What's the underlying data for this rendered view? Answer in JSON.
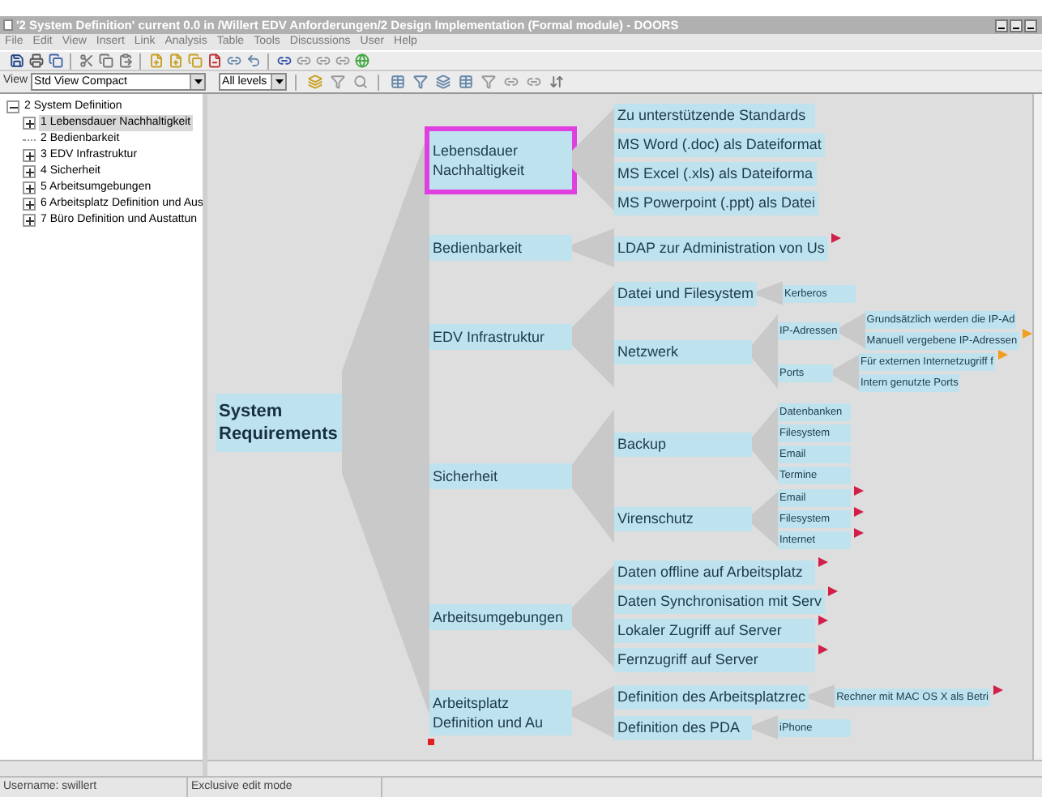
{
  "window": {
    "title": "'2 System Definition' current 0.0 in /Willert EDV Anforderungen/2 Design Implementation (Formal module) - DOORS"
  },
  "menu": [
    "File",
    "Edit",
    "View",
    "Insert",
    "Link",
    "Analysis",
    "Table",
    "Tools",
    "Discussions",
    "User",
    "Help"
  ],
  "view_bar": {
    "label": "View",
    "view": "Std View Compact",
    "levels": "All levels"
  },
  "sidebar": {
    "items": [
      {
        "label": "2 System Definition",
        "has_children": true,
        "expanded": true,
        "selected": false,
        "children": [
          {
            "label": "1 Lebensdauer Nachhaltigkeit",
            "has_children": true,
            "expanded": false,
            "selected": true
          },
          {
            "label": "2 Bedienbarkeit",
            "has_children": false,
            "expanded": false,
            "selected": false
          },
          {
            "label": "3 EDV Infrastruktur",
            "has_children": true,
            "expanded": false,
            "selected": false
          },
          {
            "label": "4 Sicherheit",
            "has_children": true,
            "expanded": false,
            "selected": false
          },
          {
            "label": "5 Arbeitsumgebungen",
            "has_children": true,
            "expanded": false,
            "selected": false
          },
          {
            "label": "6 Arbeitsplatz Definition und Aus",
            "has_children": true,
            "expanded": false,
            "selected": false
          },
          {
            "label": "7 Büro Definition und Austattun",
            "has_children": true,
            "expanded": false,
            "selected": false
          }
        ]
      }
    ]
  },
  "mindmap": {
    "label": "System Requirements",
    "selected": false,
    "children": [
      {
        "label": "Lebensdauer Nachhaltigkeit",
        "selected": true,
        "children": [
          {
            "label": "Zu unterstützende Standards",
            "selected": false
          },
          {
            "label": "MS Word (.doc) als Dateiformat",
            "selected": false
          },
          {
            "label": "MS Excel (.xls) als Dateiforma",
            "selected": false
          },
          {
            "label": "MS Powerpoint (.ppt) als Datei",
            "selected": false
          }
        ]
      },
      {
        "label": "Bedienbarkeit",
        "selected": false,
        "children": [
          {
            "label": "LDAP zur Administration von Us",
            "selected": false,
            "color": "#d0204a"
          }
        ]
      },
      {
        "label": "EDV Infrastruktur",
        "selected": false,
        "children": [
          {
            "label": "Datei und Filesystem",
            "selected": false,
            "children": [
              {
                "label": "Kerberos",
                "selected": false
              }
            ]
          },
          {
            "label": "Netzwerk",
            "selected": false,
            "children": [
              {
                "label": "IP-Adressen",
                "selected": false,
                "children": [
                  {
                    "label": "Grundsätzlich werden die IP-Ad",
                    "selected": false
                  },
                  {
                    "label": "Manuell vergebene IP-Adressen",
                    "selected": false,
                    "color": "#f0a020"
                  }
                ]
              },
              {
                "label": "Ports",
                "selected": false,
                "children": [
                  {
                    "label": "Für externen Internetzugriff f",
                    "selected": false,
                    "color": "#f0a020"
                  },
                  {
                    "label": "Intern genutzte Ports",
                    "selected": false
                  }
                ]
              }
            ]
          }
        ]
      },
      {
        "label": "Sicherheit",
        "selected": false,
        "children": [
          {
            "label": "Backup",
            "selected": false,
            "children": [
              {
                "label": "Datenbanken",
                "selected": false
              },
              {
                "label": "Filesystem",
                "selected": false
              },
              {
                "label": "Email",
                "selected": false
              },
              {
                "label": "Termine",
                "selected": false
              }
            ]
          },
          {
            "label": "Virenschutz",
            "selected": false,
            "children": [
              {
                "label": "Email",
                "selected": false,
                "color": "#d0204a"
              },
              {
                "label": "Filesystem",
                "selected": false,
                "color": "#d0204a"
              },
              {
                "label": "Internet",
                "selected": false,
                "color": "#d0204a"
              }
            ]
          }
        ]
      },
      {
        "label": "Arbeitsumgebungen",
        "selected": false,
        "children": [
          {
            "label": "Daten offline auf Arbeitsplatz",
            "selected": false,
            "color": "#d0204a"
          },
          {
            "label": "Daten Synchronisation mit Serv",
            "selected": false,
            "color": "#d0204a"
          },
          {
            "label": "Lokaler Zugriff auf Server",
            "selected": false,
            "color": "#d0204a"
          },
          {
            "label": "Fernzugriff auf Server",
            "selected": false,
            "color": "#d0204a"
          }
        ]
      },
      {
        "label": "Arbeitsplatz Definition und Au",
        "selected": false,
        "children": [
          {
            "label": "Definition des Arbeitsplatzrec",
            "selected": false,
            "children": [
              {
                "label": "Rechner mit MAC OS X als Betri",
                "selected": false,
                "color": "#d0204a"
              }
            ]
          },
          {
            "label": "Definition des PDA",
            "selected": false,
            "children": [
              {
                "label": "iPhone",
                "selected": false
              }
            ]
          }
        ]
      }
    ]
  },
  "status_bar": [
    "Username: swillert",
    "Exclusive edit mode"
  ]
}
